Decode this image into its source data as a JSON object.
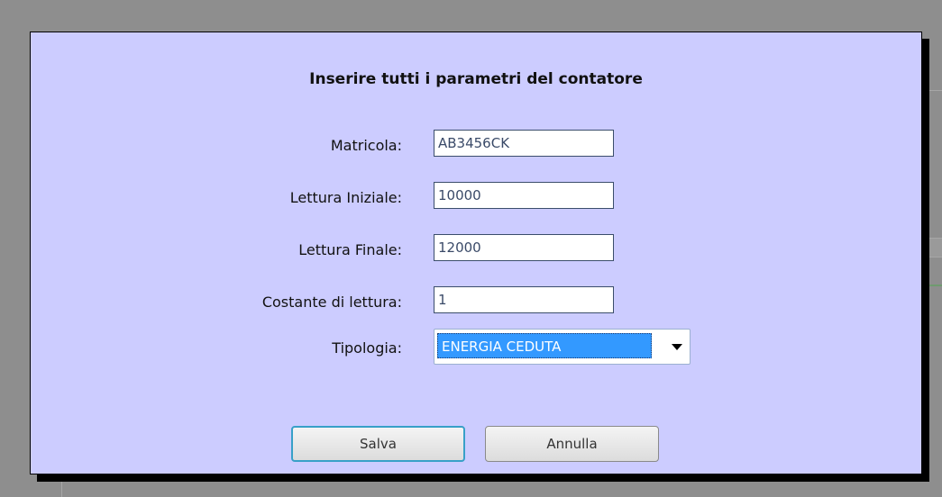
{
  "dialog": {
    "title": "Inserire tutti i parametri del contatore",
    "fields": [
      {
        "label": "Matricola:",
        "value": "AB3456CK"
      },
      {
        "label": "Lettura Iniziale:",
        "value": "10000"
      },
      {
        "label": "Lettura Finale:",
        "value": "12000"
      },
      {
        "label": "Costante di lettura:",
        "value": "1"
      }
    ],
    "tipologia": {
      "label": "Tipologia:",
      "selected": "ENERGIA CEDUTA"
    },
    "buttons": {
      "save": "Salva",
      "cancel": "Annulla"
    }
  },
  "colors": {
    "dialog_bg": "#ccccff",
    "overlay": "#8f8f8f",
    "selection": "#3399ff"
  }
}
